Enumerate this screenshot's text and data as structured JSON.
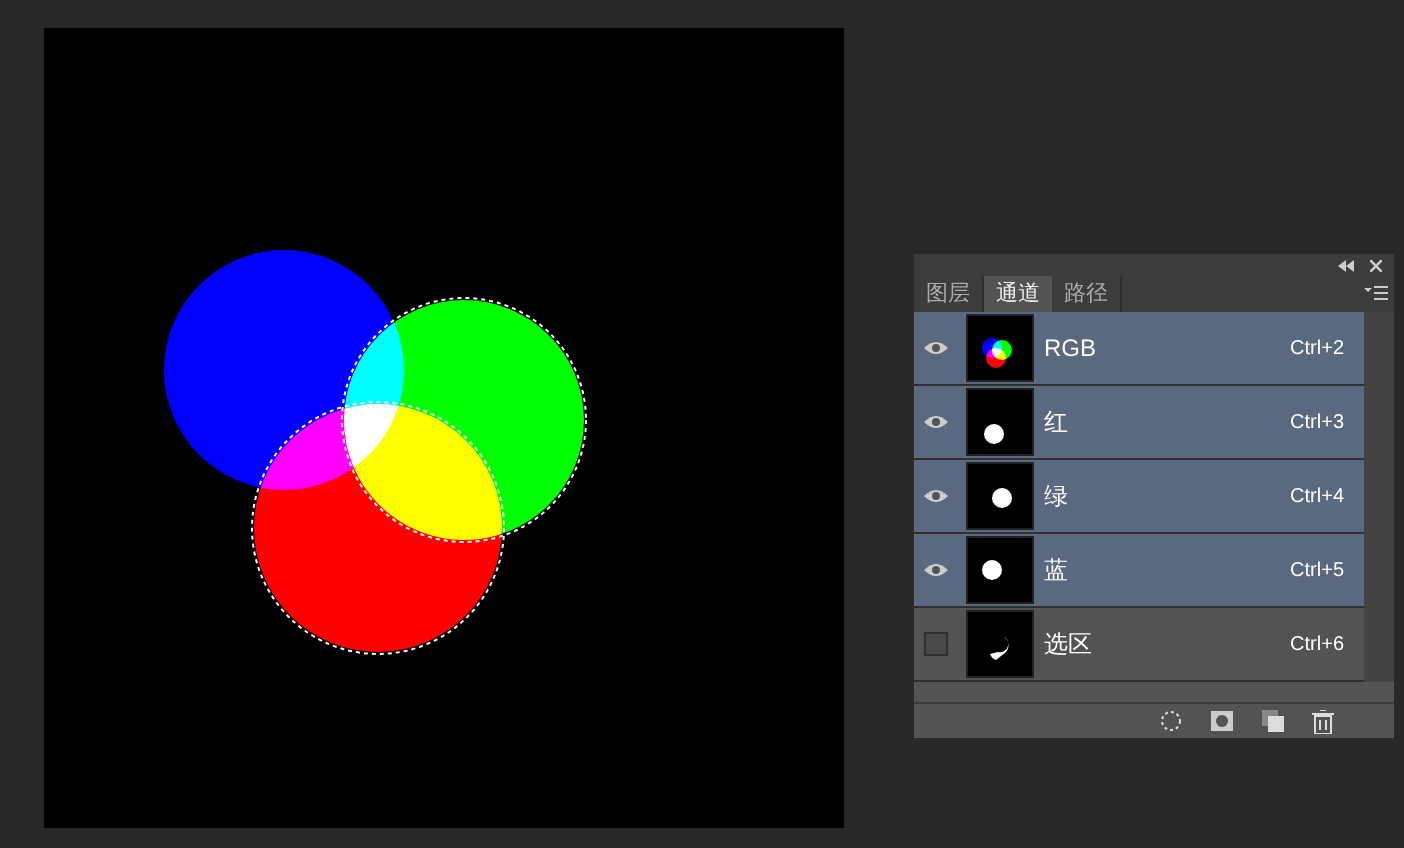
{
  "panel": {
    "tabs": [
      {
        "label": "图层",
        "selected": false
      },
      {
        "label": "通道",
        "selected": true
      },
      {
        "label": "路径",
        "selected": false
      }
    ],
    "channels": [
      {
        "name": "RGB",
        "shortcut": "Ctrl+2",
        "visible": true,
        "selected": true,
        "kind": "composite"
      },
      {
        "name": "红",
        "shortcut": "Ctrl+3",
        "visible": true,
        "selected": true,
        "kind": "red"
      },
      {
        "name": "绿",
        "shortcut": "Ctrl+4",
        "visible": true,
        "selected": true,
        "kind": "green"
      },
      {
        "name": "蓝",
        "shortcut": "Ctrl+5",
        "visible": true,
        "selected": true,
        "kind": "blue"
      },
      {
        "name": "选区",
        "shortcut": "Ctrl+6",
        "visible": false,
        "selected": false,
        "kind": "selection"
      }
    ]
  }
}
